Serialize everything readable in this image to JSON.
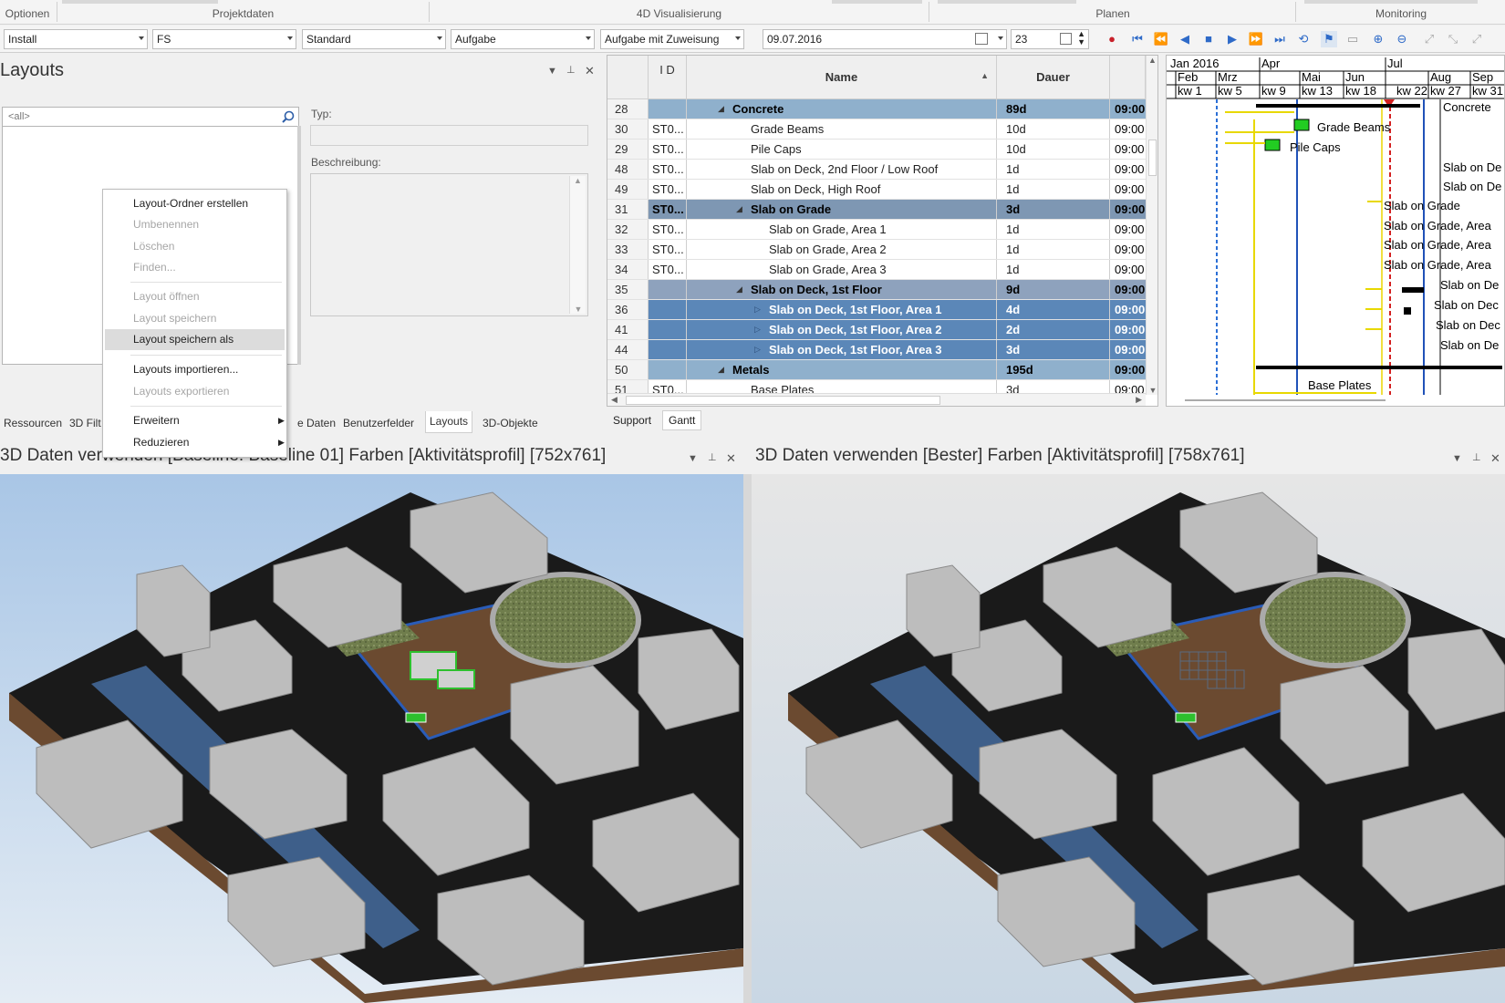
{
  "ribbon": {
    "groups": [
      "Optionen",
      "Projektdaten",
      "4D Visualisierung",
      "Planen",
      "Monitoring"
    ]
  },
  "toolbar": {
    "combo1": "Install",
    "combo2": "FS",
    "combo3": "Standard",
    "combo4": "Aufgabe",
    "combo5": "Aufgabe mit Zuweisung",
    "date": "09.07.2016",
    "number": "23"
  },
  "layouts_panel": {
    "title": "Layouts",
    "search_placeholder": "<all>",
    "typ_label": "Typ:",
    "beschreibung_label": "Beschreibung:",
    "context_menu": {
      "items": [
        {
          "label": "Layout-Ordner erstellen"
        },
        {
          "label": "Umbenennen"
        },
        {
          "label": "Löschen"
        },
        {
          "label": "Finden..."
        },
        {
          "label": "Layout öffnen"
        },
        {
          "label": "Layout speichern"
        },
        {
          "label": "Layout speichern als"
        },
        {
          "label": "Layouts importieren..."
        },
        {
          "label": "Layouts exportieren"
        },
        {
          "label": "Erweitern"
        },
        {
          "label": "Reduzieren"
        }
      ]
    },
    "tabs": [
      "Ressourcen",
      "3D Filt",
      "e Daten",
      "Benutzerfelder",
      "Layouts",
      "3D-Objekte"
    ]
  },
  "grid": {
    "headers": {
      "id": "I D",
      "name": "Name",
      "dauer": "Dauer"
    },
    "rows": [
      {
        "n": "28",
        "id": "",
        "name": "Concrete",
        "dur": "89d",
        "start": "09:00"
      },
      {
        "n": "30",
        "id": "ST0...",
        "name": "Grade Beams",
        "dur": "10d",
        "start": "09:00"
      },
      {
        "n": "29",
        "id": "ST0...",
        "name": "Pile Caps",
        "dur": "10d",
        "start": "09:00"
      },
      {
        "n": "48",
        "id": "ST0...",
        "name": "Slab on Deck, 2nd Floor / Low Roof",
        "dur": "1d",
        "start": "09:00"
      },
      {
        "n": "49",
        "id": "ST0...",
        "name": "Slab on Deck, High Roof",
        "dur": "1d",
        "start": "09:00"
      },
      {
        "n": "31",
        "id": "ST0...",
        "name": "Slab on Grade",
        "dur": "3d",
        "start": "09:00"
      },
      {
        "n": "32",
        "id": "ST0...",
        "name": "Slab on Grade, Area 1",
        "dur": "1d",
        "start": "09:00"
      },
      {
        "n": "33",
        "id": "ST0...",
        "name": "Slab on Grade, Area 2",
        "dur": "1d",
        "start": "09:00"
      },
      {
        "n": "34",
        "id": "ST0...",
        "name": "Slab on Grade, Area 3",
        "dur": "1d",
        "start": "09:00"
      },
      {
        "n": "35",
        "id": "",
        "name": "Slab on Deck, 1st Floor",
        "dur": "9d",
        "start": "09:00"
      },
      {
        "n": "36",
        "id": "",
        "name": "Slab on Deck, 1st Floor, Area 1",
        "dur": "4d",
        "start": "09:00"
      },
      {
        "n": "41",
        "id": "",
        "name": "Slab on Deck, 1st Floor, Area 2",
        "dur": "2d",
        "start": "09:00"
      },
      {
        "n": "44",
        "id": "",
        "name": "Slab on Deck, 1st Floor, Area 3",
        "dur": "3d",
        "start": "09:00"
      },
      {
        "n": "50",
        "id": "",
        "name": "Metals",
        "dur": "195d",
        "start": "09:00"
      },
      {
        "n": "51",
        "id": "ST0...",
        "name": "Base Plates",
        "dur": "3d",
        "start": "09:00"
      }
    ],
    "tabs": [
      "Support",
      "Gantt"
    ]
  },
  "gantt": {
    "months": [
      "Jan 2016",
      "Feb",
      "Mrz",
      "Apr",
      "Mai",
      "Jun",
      "Jul",
      "Aug",
      "Sep"
    ],
    "weeks": [
      "kw 1",
      "kw 5",
      "kw 9",
      "kw 13",
      "kw 18",
      "kw 22",
      "kw 27",
      "kw 31"
    ],
    "labels": [
      "Concrete",
      "Grade Beams",
      "Pile Caps",
      "Slab on De",
      "Slab on De",
      "Slab on Grade",
      "Slab on Grade, Area",
      "Slab on Grade, Area",
      "Slab on Grade, Area",
      "Slab on De",
      "Slab on Dec",
      "Slab on Dec",
      "Slab on De",
      "Base Plates"
    ]
  },
  "viewports": {
    "left_title": "3D Daten verwenden [Baseline: Baseline 01] Farben [Aktivitätsprofil]   [752x761]",
    "right_title": "3D Daten verwenden [Bester] Farben [Aktivitätsprofil]   [758x761]"
  },
  "colors": {
    "selected_row": "#5b87b8",
    "summary_row": "#8fb0cc",
    "today_line": "#d42020",
    "ground": "#6b4a30",
    "water": "#3e5f8a",
    "grass": "#6f7d4c"
  }
}
